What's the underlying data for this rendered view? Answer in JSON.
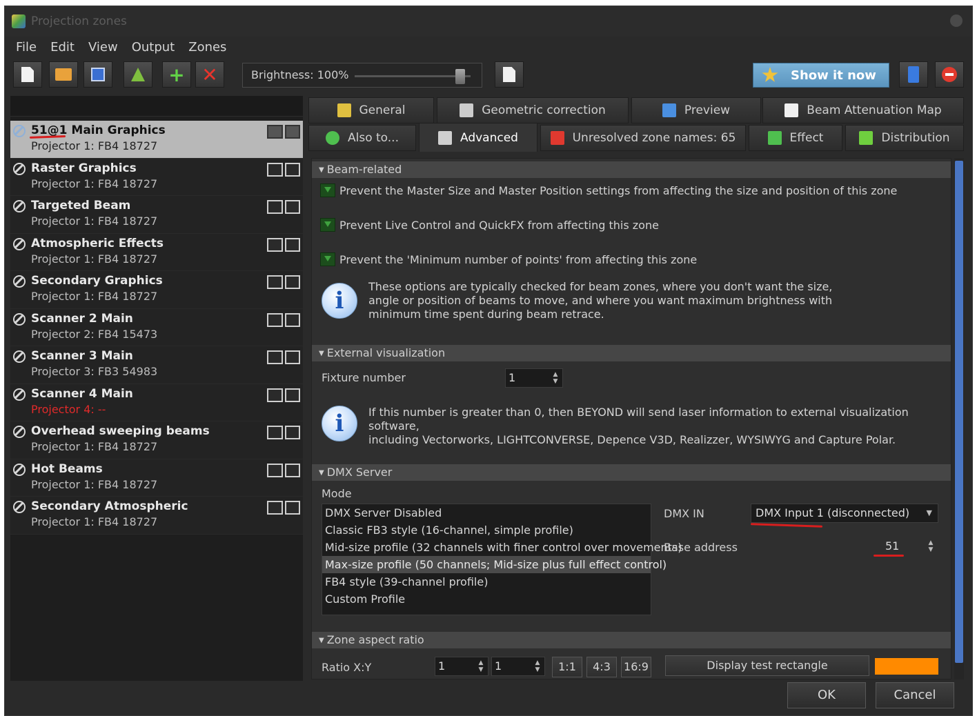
{
  "window": {
    "title": "Projection zones"
  },
  "menu": [
    "File",
    "Edit",
    "View",
    "Output",
    "Zones"
  ],
  "toolbar": {
    "brightness_label": "Brightness: 100%",
    "brightness_value": 1.0,
    "show_it_now": "Show it now"
  },
  "zones": [
    {
      "name": "51@1 Main Graphics",
      "projector": "Projector 1: FB4 18727",
      "selected": true,
      "error": false
    },
    {
      "name": "Raster Graphics",
      "projector": "Projector 1: FB4 18727",
      "selected": false,
      "error": false
    },
    {
      "name": "Targeted Beam",
      "projector": "Projector 1: FB4 18727",
      "selected": false,
      "error": false
    },
    {
      "name": "Atmospheric Effects",
      "projector": "Projector 1: FB4 18727",
      "selected": false,
      "error": false
    },
    {
      "name": "Secondary Graphics",
      "projector": "Projector 1: FB4 18727",
      "selected": false,
      "error": false
    },
    {
      "name": "Scanner 2 Main",
      "projector": "Projector 2: FB4 15473",
      "selected": false,
      "error": false
    },
    {
      "name": "Scanner 3 Main",
      "projector": "Projector 3: FB3 54983",
      "selected": false,
      "error": false
    },
    {
      "name": "Scanner 4 Main",
      "projector": "Projector 4: --",
      "selected": false,
      "error": true
    },
    {
      "name": "Overhead sweeping beams",
      "projector": "Projector 1: FB4 18727",
      "selected": false,
      "error": false
    },
    {
      "name": "Hot Beams",
      "projector": "Projector 1: FB4 18727",
      "selected": false,
      "error": false
    },
    {
      "name": "Secondary Atmospheric",
      "projector": "Projector 1: FB4 18727",
      "selected": false,
      "error": false
    }
  ],
  "tabs_row1": [
    {
      "label": "General",
      "icon": "general-icon"
    },
    {
      "label": "Geometric correction",
      "icon": "grid-icon"
    },
    {
      "label": "Preview",
      "icon": "monitor-icon"
    },
    {
      "label": "Beam Attenuation Map",
      "icon": "checker-icon"
    }
  ],
  "tabs_row2": [
    {
      "label": "Also to...",
      "icon": "plus-circle-icon"
    },
    {
      "label": "Advanced",
      "icon": "tools-icon",
      "active": true
    },
    {
      "label": "Unresolved zone names: 65",
      "icon": "x-icon"
    },
    {
      "label": "Effect",
      "icon": "sigma-icon"
    },
    {
      "label": "Distribution",
      "icon": "distribution-icon"
    }
  ],
  "beam": {
    "header": "Beam-related",
    "options": [
      "Prevent the Master Size and Master Position settings from affecting the size and position of this zone",
      "Prevent Live Control and QuickFX from affecting this zone",
      "Prevent the 'Minimum number of points' from affecting this zone"
    ],
    "info_lines": [
      "These options are typically checked for beam zones, where you don't want the size,",
      "angle or position of beams to move, and where you want maximum brightness with",
      "minimum time spent during beam retrace."
    ]
  },
  "external": {
    "header": "External visualization",
    "fixture_label": "Fixture number",
    "fixture_value": "1",
    "info_lines": [
      "If this number is greater than 0, then BEYOND will send laser information to external visualization software,",
      "including Vectorworks, LIGHTCONVERSE, Depence V3D, Realizzer, WYSIWYG and Capture Polar."
    ]
  },
  "dmx": {
    "header": "DMX Server",
    "mode_label": "Mode",
    "modes": [
      "DMX Server Disabled",
      "Classic FB3 style (16-channel, simple profile)",
      "Mid-size profile (32 channels with finer control over movements)",
      "Max-size profile (50 channels; Mid-size plus full effect control)",
      "FB4 style (39-channel profile)",
      "Custom Profile"
    ],
    "selected_mode": 3,
    "dmx_in_label": "DMX IN",
    "dmx_in_value": "DMX Input 1 (disconnected)",
    "base_address_label": "Base address",
    "base_address_value": "51"
  },
  "aspect": {
    "header": "Zone aspect ratio",
    "ratio_label": "Ratio X:Y",
    "x": "1",
    "y": "1",
    "presets": [
      "1:1",
      "4:3",
      "16:9"
    ],
    "test_button": "Display test rectangle",
    "color": "#ff8a00"
  },
  "buttons": {
    "ok": "OK",
    "cancel": "Cancel"
  }
}
